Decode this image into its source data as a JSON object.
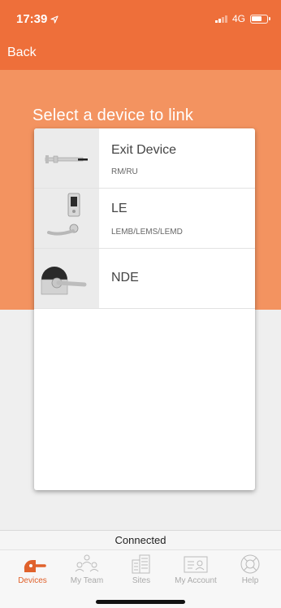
{
  "status_bar": {
    "time": "17:39",
    "network": "4G"
  },
  "nav": {
    "back_label": "Back"
  },
  "hero": {
    "title": "Select a device to link"
  },
  "devices": [
    {
      "name": "Exit Device",
      "sub": "RM/RU"
    },
    {
      "name": "LE",
      "sub": "LEMB/LEMS/LEMD"
    },
    {
      "name": "NDE",
      "sub": ""
    }
  ],
  "connection": {
    "status": "Connected"
  },
  "tabs": [
    {
      "label": "Devices",
      "icon": "devices-lock-icon",
      "active": true
    },
    {
      "label": "My Team",
      "icon": "team-icon",
      "active": false
    },
    {
      "label": "Sites",
      "icon": "buildings-icon",
      "active": false
    },
    {
      "label": "My Account",
      "icon": "id-card-icon",
      "active": false
    },
    {
      "label": "Help",
      "icon": "lifebuoy-icon",
      "active": false
    }
  ],
  "colors": {
    "brand": "#ee6f3a",
    "hero": "#f39360",
    "active_tab": "#e0622c",
    "inactive_tab": "#aaaaaa"
  }
}
